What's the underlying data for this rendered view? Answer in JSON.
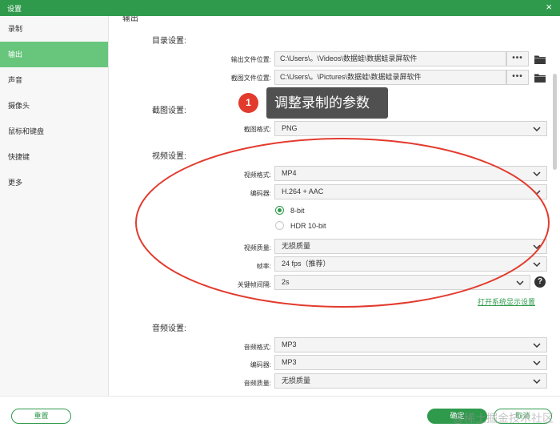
{
  "window": {
    "title": "设置",
    "close_glyph": "×"
  },
  "sidebar": {
    "items": [
      {
        "label": "录制"
      },
      {
        "label": "输出",
        "active": true
      },
      {
        "label": "声音"
      },
      {
        "label": "摄像头"
      },
      {
        "label": "鼠标和键盘"
      },
      {
        "label": "快捷键"
      },
      {
        "label": "更多"
      }
    ]
  },
  "main": {
    "cut_heading": "输出",
    "dir": {
      "heading": "目录设置:",
      "output_label": "输出文件位置:",
      "output_value": "C:\\Users\\。\\Videos\\数据蛙\\数据蛙录屏软件",
      "shot_label": "截图文件位置:",
      "shot_value": "C:\\Users\\。\\Pictures\\数据蛙\\数据蛙录屏软件",
      "browse_glyph": "•••"
    },
    "screenshot": {
      "heading": "截图设置:",
      "format_label": "截图格式:",
      "format_value": "PNG"
    },
    "video": {
      "heading": "视频设置:",
      "format_label": "视频格式:",
      "format_value": "MP4",
      "encoder_label": "编码器:",
      "encoder_value": "H.264 + AAC",
      "bit8": "8-bit",
      "hdr": "HDR 10-bit",
      "quality_label": "视频质量:",
      "quality_value": "无损质量",
      "fps_label": "帧率:",
      "fps_value": "24 fps（推荐）",
      "key_label": "关键帧间隔:",
      "key_value": "2s",
      "help_glyph": "?",
      "open_link": "打开系统显示设置"
    },
    "audio": {
      "heading": "音频设置:",
      "format_label": "音频格式:",
      "format_value": "MP3",
      "encoder_label": "编码器:",
      "encoder_value": "MP3",
      "quality_label": "音频质量:",
      "quality_value": "无损质量"
    }
  },
  "annotation": {
    "badge": "1",
    "text": "调整录制的参数",
    "color": "#e23b2e"
  },
  "footer": {
    "reset": "重置",
    "ok": "确定",
    "cancel": "取消"
  },
  "watermark": "@稀土掘金技术社区",
  "colors": {
    "accent": "#2f9a4c",
    "sidebar_active": "#68c57c"
  }
}
